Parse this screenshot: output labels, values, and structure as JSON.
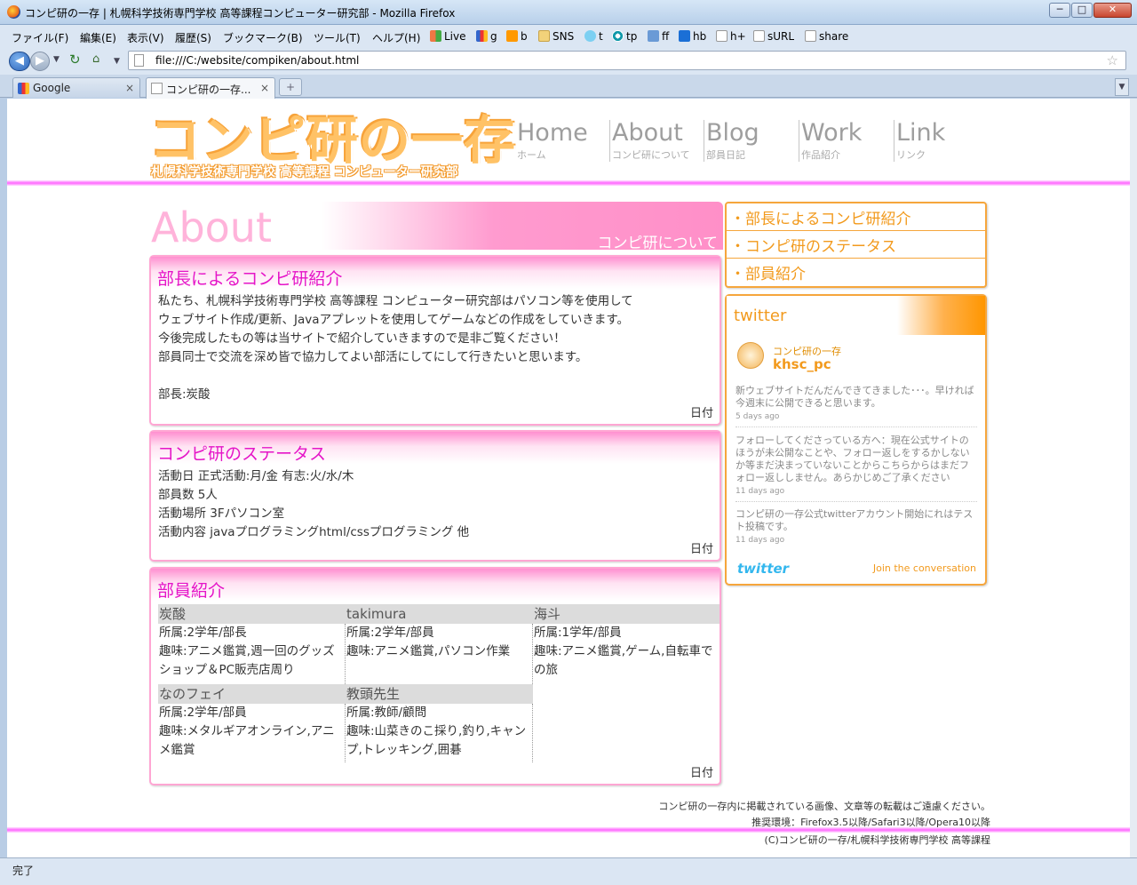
{
  "window": {
    "title": "コンピ研の一存 | 札幌科学技術専門学校 高等課程コンピューター研究部 - Mozilla Firefox",
    "min": "─",
    "max": "□",
    "close": "✕"
  },
  "menu": [
    "ファイル(F)",
    "編集(E)",
    "表示(V)",
    "履歴(S)",
    "ブックマーク(B)",
    "ツール(T)",
    "ヘルプ(H)"
  ],
  "bookmarks": [
    "Live",
    "g",
    "b",
    "SNS",
    "t",
    "tp",
    "ff",
    "hb",
    "h+",
    "sURL",
    "share"
  ],
  "nav": {
    "url": "file:///C:/website/compiken/about.html"
  },
  "tabs": [
    {
      "label": "Google"
    },
    {
      "label": "コンピ研の一存..."
    }
  ],
  "status": "完了",
  "site": {
    "logo": "コンピ研の一存",
    "logo_sub": "札幌科学技術専門学校 高等課程 コンピューター研究部",
    "gnav": [
      {
        "en": "Home",
        "jp": "ホーム"
      },
      {
        "en": "About",
        "jp": "コンピ研について"
      },
      {
        "en": "Blog",
        "jp": "部員日記"
      },
      {
        "en": "Work",
        "jp": "作品紹介"
      },
      {
        "en": "Link",
        "jp": "リンク"
      }
    ],
    "about_en": "About",
    "about_jp": "コンピ研について"
  },
  "intro": {
    "title": "部長によるコンピ研紹介",
    "lines": [
      "私たち、札幌科学技術専門学校 高等課程 コンピューター研究部はパソコン等を使用して",
      "ウェブサイト作成/更新、Javaアプレットを使用してゲームなどの作成をしていきます。",
      "今後完成したもの等は当サイトで紹介していきますので是非ご覧ください！",
      "部員同士で交流を深め皆で協力してよい部活にしてにして行きたいと思います。"
    ],
    "leader": "部長:炭酸",
    "date": "日付"
  },
  "status_panel": {
    "title": "コンピ研のステータス",
    "lines": [
      "活動日 正式活動:月/金 有志:火/水/木",
      "部員数 5人",
      "活動場所 3Fパソコン室",
      "活動内容 javaプログラミングhtml/cssプログラミング 他"
    ],
    "date": "日付"
  },
  "members_panel": {
    "title": "部員紹介",
    "date": "日付",
    "members": [
      {
        "name": "炭酸",
        "affil": "所属:2学年/部長",
        "hobby": "趣味:アニメ鑑賞,週一回のグッズショップ＆PC販売店周り"
      },
      {
        "name": "takimura",
        "affil": "所属:2学年/部員",
        "hobby": "趣味:アニメ鑑賞,パソコン作業"
      },
      {
        "name": "海斗",
        "affil": "所属:1学年/部員",
        "hobby": "趣味:アニメ鑑賞,ゲーム,自転車での旅"
      },
      {
        "name": "なのフェイ",
        "affil": "所属:2学年/部員",
        "hobby": "趣味:メタルギアオンライン,アニメ鑑賞"
      },
      {
        "name": "教頭先生",
        "affil": "所属:教師/顧問",
        "hobby": "趣味:山菜きのこ採り,釣り,キャンプ,トレッキング,囲碁"
      }
    ]
  },
  "sidebar": {
    "links": [
      "・部長によるコンピ研紹介",
      "・コンピ研のステータス",
      "・部員紹介"
    ]
  },
  "twitter": {
    "header": "twitter",
    "display_name": "コンピ研の一存",
    "handle": "khsc_pc",
    "tweets": [
      {
        "text": "新ウェブサイトだんだんできてきました･･･。早ければ今週末に公開できると思います。",
        "ago": "5 days ago"
      },
      {
        "text": "フォローしてくださっている方へ：現在公式サイトのほうが未公開なことや、フォロー返しをするかしないか等まだ決まっていないことからこちらからはまだフォロー返ししません。あらかじめご了承ください",
        "ago": "11 days ago"
      },
      {
        "text": "コンピ研の一存公式twitterアカウント開始にれはテスト投稿です。",
        "ago": "11 days ago"
      }
    ],
    "logo": "twitter",
    "join": "Join the conversation"
  },
  "footer": [
    "コンピ研の一存内に掲載されている画像、文章等の転載はご遠慮ください。",
    "推奨環境：Firefox3.5以降/Safari3以降/Opera10以降",
    "(C)コンピ研の一存/札幌科学技術専門学校 高等課程"
  ]
}
